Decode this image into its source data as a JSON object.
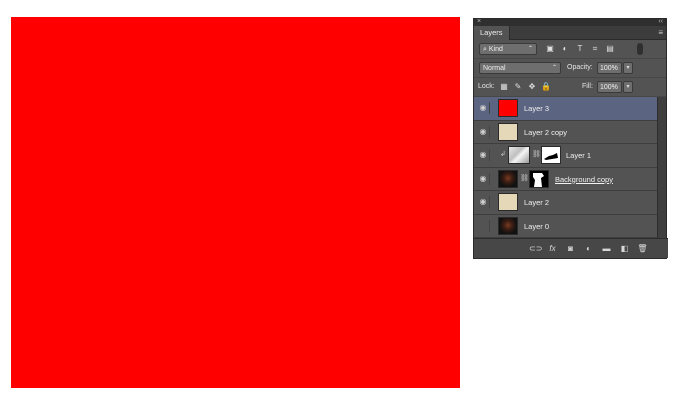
{
  "canvas": {
    "fill_color": "#ff0000"
  },
  "panel": {
    "close_glyph": "×",
    "collapse_glyph": "‹‹",
    "tab_label": "Layers",
    "menu_glyph": "≡",
    "filter": {
      "kind_label": "Kind",
      "icons": [
        "image-filter-icon",
        "adjustment-filter-icon",
        "type-filter-icon",
        "shape-filter-icon",
        "smart-object-filter-icon"
      ]
    },
    "blend_mode": "Normal",
    "opacity_label": "Opacity:",
    "opacity_value": "100%",
    "lock_label": "Lock:",
    "fill_label": "Fill:",
    "fill_value": "100%",
    "layers": [
      {
        "name": "Layer 3",
        "visible": true,
        "selected": true,
        "thumb": "#ff0000"
      },
      {
        "name": "Layer 2 copy",
        "visible": true,
        "selected": false,
        "thumb": "#e4d8b8"
      },
      {
        "name": "Layer 1",
        "visible": true,
        "selected": false,
        "thumb": "photo-mask",
        "clipped": true,
        "masked": true
      },
      {
        "name": "Background copy",
        "visible": true,
        "selected": false,
        "thumb": "portrait",
        "masked": true,
        "underlined": true
      },
      {
        "name": "Layer 2",
        "visible": true,
        "selected": false,
        "thumb": "#e4d8b8"
      },
      {
        "name": "Layer 0",
        "visible": false,
        "selected": false,
        "thumb": "portrait"
      }
    ],
    "bottom_icons": [
      "link-layers-icon",
      "fx-icon",
      "add-mask-icon",
      "adjustment-layer-icon",
      "new-group-icon",
      "new-layer-icon",
      "trash-icon"
    ],
    "fx_label": "fx"
  }
}
